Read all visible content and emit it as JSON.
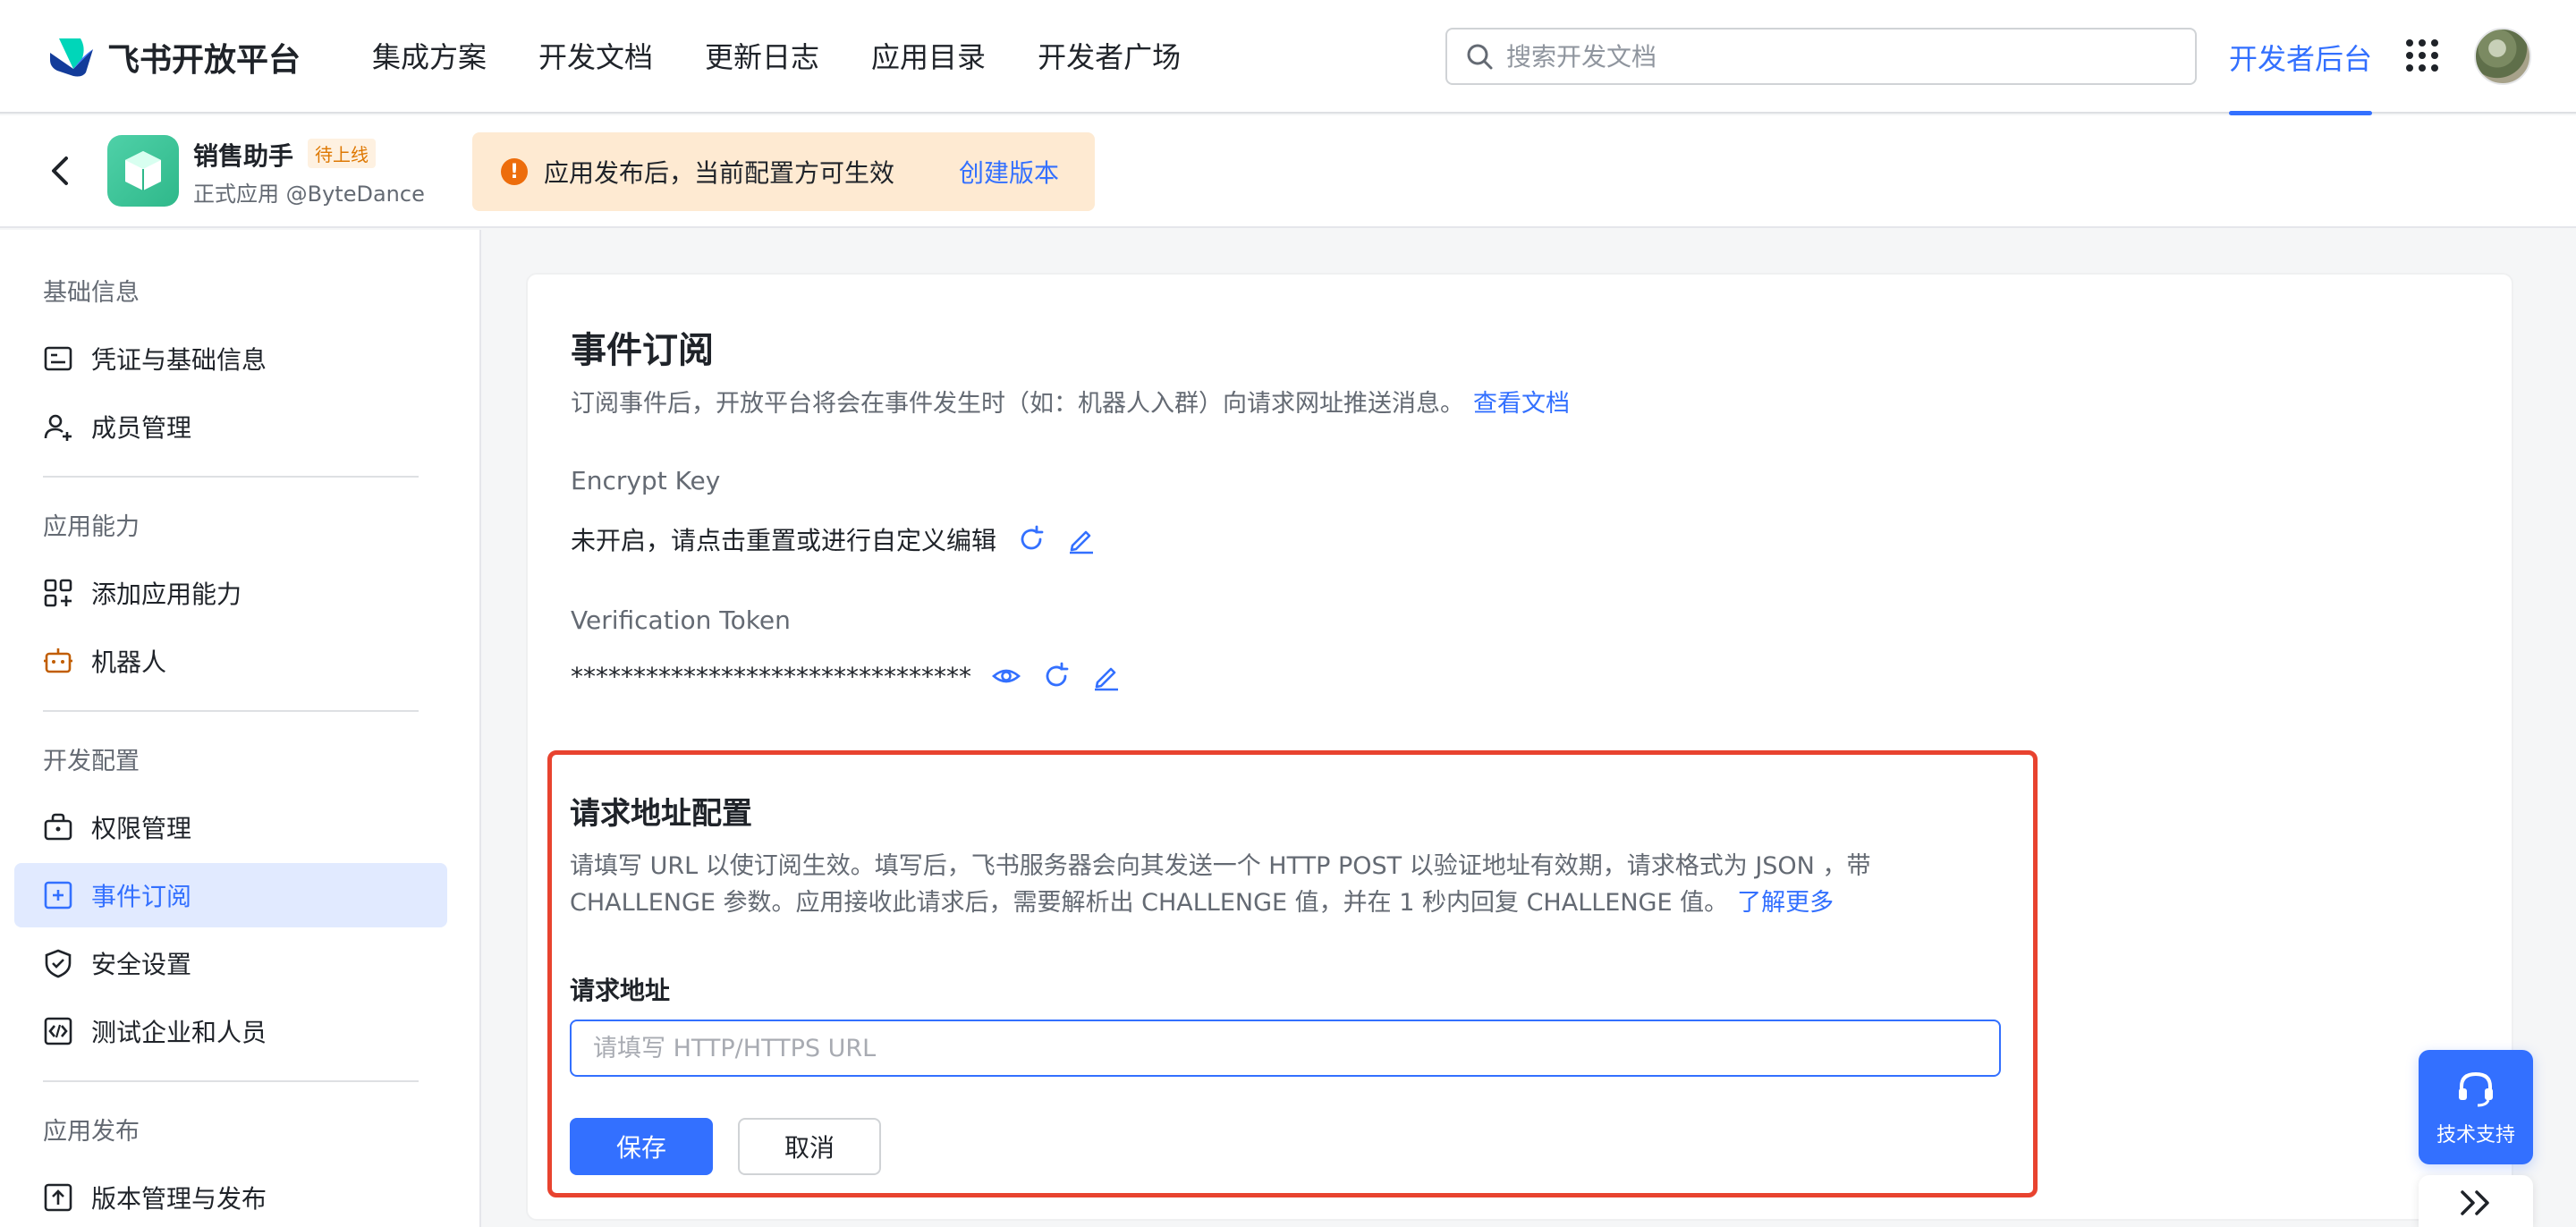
{
  "brand": {
    "name": "飞书开放平台"
  },
  "nav": {
    "menu": [
      "集成方案",
      "开发文档",
      "更新日志",
      "应用目录",
      "开发者广场"
    ],
    "search_placeholder": "搜索开发文档",
    "dev_backend": "开发者后台",
    "active_color": "#3370ff"
  },
  "app": {
    "name": "销售助手",
    "badge": "待上线",
    "subtitle": "正式应用 @ByteDance",
    "notice_text": "应用发布后，当前配置方可生效",
    "notice_link": "创建版本"
  },
  "sidebar": {
    "groups": [
      {
        "title": "基础信息",
        "items": [
          {
            "label": "凭证与基础信息",
            "icon": "credential-icon"
          },
          {
            "label": "成员管理",
            "icon": "member-add-icon"
          }
        ]
      },
      {
        "title": "应用能力",
        "items": [
          {
            "label": "添加应用能力",
            "icon": "apps-add-icon"
          },
          {
            "label": "机器人",
            "icon": "robot-icon"
          }
        ]
      },
      {
        "title": "开发配置",
        "items": [
          {
            "label": "权限管理",
            "icon": "permission-icon"
          },
          {
            "label": "事件订阅",
            "icon": "event-icon",
            "active": true
          },
          {
            "label": "安全设置",
            "icon": "shield-icon"
          },
          {
            "label": "测试企业和人员",
            "icon": "code-icon"
          }
        ]
      },
      {
        "title": "应用发布",
        "items": [
          {
            "label": "版本管理与发布",
            "icon": "upload-icon"
          }
        ]
      }
    ]
  },
  "main": {
    "title": "事件订阅",
    "description": "订阅事件后，开放平台将会在事件发生时（如：机器人入群）向请求网址推送消息。",
    "doc_link": "查看文档",
    "encrypt_key": {
      "label": "Encrypt Key",
      "value": "未开启，请点击重置或进行自定义编辑"
    },
    "verification_token": {
      "label": "Verification Token",
      "value": "********************************"
    },
    "request": {
      "title": "请求地址配置",
      "description": "请填写 URL 以使订阅生效。填写后，飞书服务器会向其发送一个 HTTP POST 以验证地址有效期，请求格式为 JSON ，带 CHALLENGE 参数。应用接收此请求后，需要解析出 CHALLENGE 值，并在 1 秒内回复 CHALLENGE 值。",
      "learn_more": "了解更多",
      "field_label": "请求地址",
      "placeholder": "请填写 HTTP/HTTPS URL",
      "value": "",
      "save": "保存",
      "cancel": "取消",
      "highlight_color": "#e8432f"
    }
  },
  "support": {
    "label": "技术支持"
  }
}
